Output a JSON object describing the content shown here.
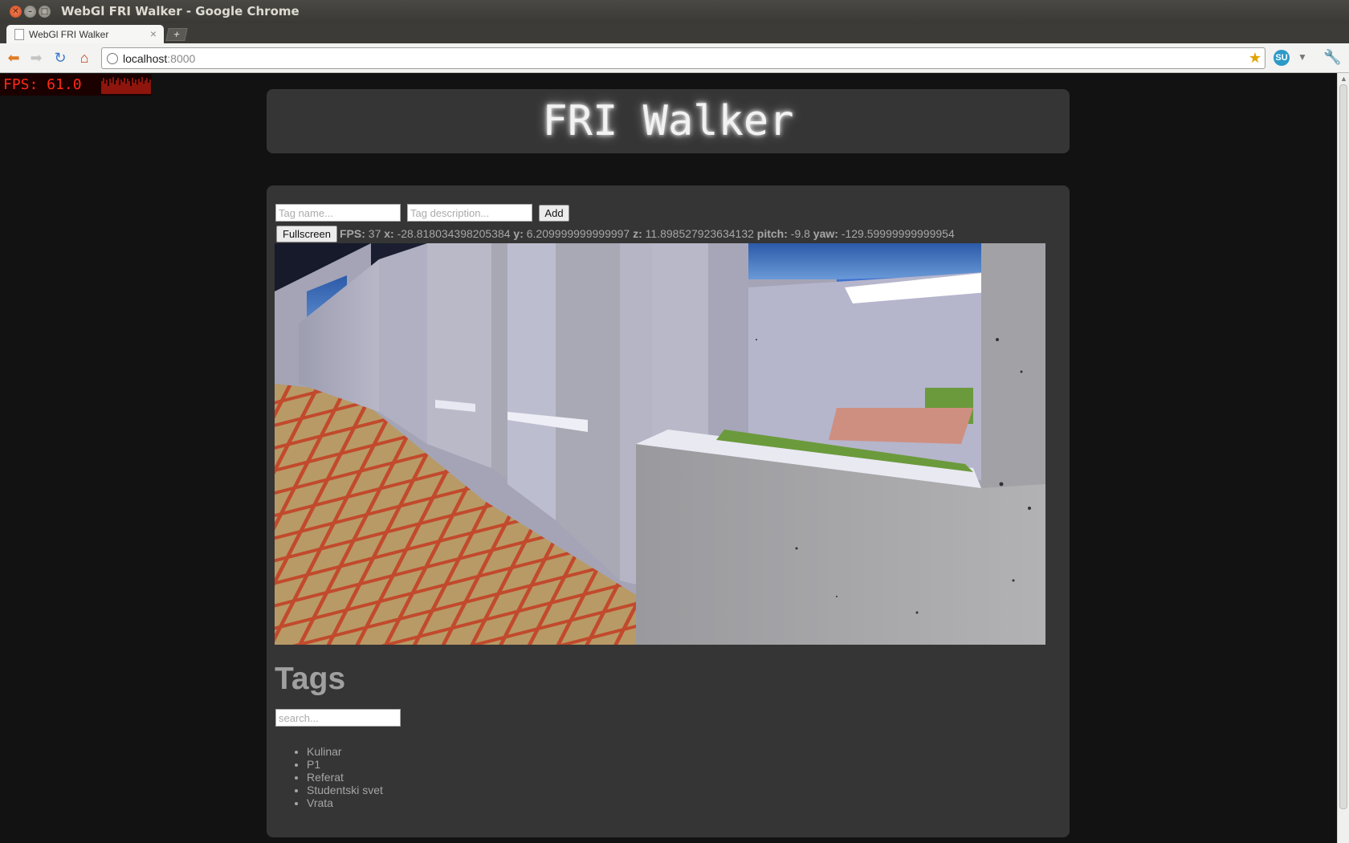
{
  "window": {
    "title": "WebGl FRI Walker - Google Chrome"
  },
  "tab": {
    "label": "WebGl FRI Walker",
    "close": "×",
    "new_tab": "+"
  },
  "browser": {
    "url_host": "localhost",
    "url_port": ":8000",
    "extension_badge": "SU"
  },
  "fps_overlay": {
    "text": "FPS:  61.0"
  },
  "page": {
    "title": "FRI Walker"
  },
  "tag_form": {
    "name_placeholder": "Tag name...",
    "description_placeholder": "Tag description...",
    "add_label": "Add"
  },
  "controls": {
    "fullscreen_label": "Fullscreen"
  },
  "status": {
    "fps_label": "FPS:",
    "fps": "37",
    "x_label": "x:",
    "x": "-28.818034398205384",
    "y_label": "y:",
    "y": "6.209999999999997",
    "z_label": "z:",
    "z": "11.898527923634132",
    "pitch_label": "pitch:",
    "pitch": "-9.8",
    "yaw_label": "yaw:",
    "yaw": "-129.59999999999954"
  },
  "tags": {
    "heading": "Tags",
    "search_placeholder": "search...",
    "items": [
      "Kulinar",
      "P1",
      "Referat",
      "Studentski svet",
      "Vrata"
    ]
  },
  "colors": {
    "fps_red": "#ff2a18",
    "panel": "#353535",
    "page_bg": "#121212",
    "wall": "#a9a9b7",
    "floor_tile": "#b89a66",
    "floor_grout": "#c24a2c",
    "sky": "#3a6ec0",
    "grass": "#6b9a3c"
  }
}
